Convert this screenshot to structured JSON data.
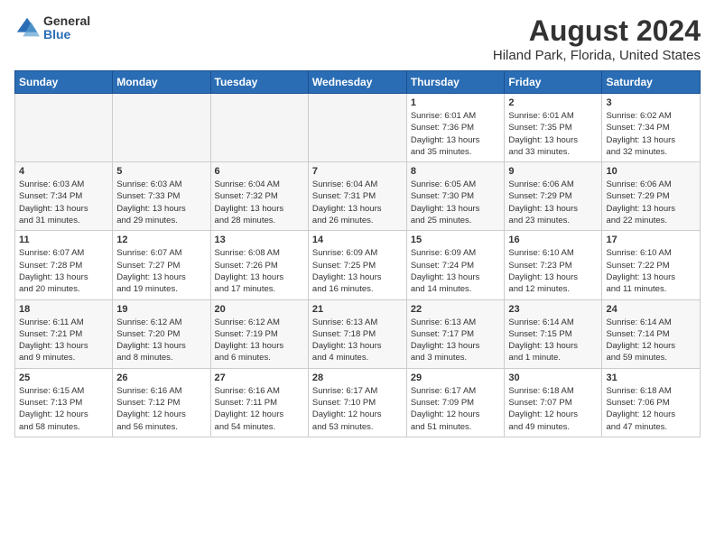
{
  "header": {
    "logo_general": "General",
    "logo_blue": "Blue",
    "title": "August 2024",
    "subtitle": "Hiland Park, Florida, United States"
  },
  "columns": [
    "Sunday",
    "Monday",
    "Tuesday",
    "Wednesday",
    "Thursday",
    "Friday",
    "Saturday"
  ],
  "weeks": [
    [
      {
        "day": "",
        "info": ""
      },
      {
        "day": "",
        "info": ""
      },
      {
        "day": "",
        "info": ""
      },
      {
        "day": "",
        "info": ""
      },
      {
        "day": "1",
        "info": "Sunrise: 6:01 AM\nSunset: 7:36 PM\nDaylight: 13 hours\nand 35 minutes."
      },
      {
        "day": "2",
        "info": "Sunrise: 6:01 AM\nSunset: 7:35 PM\nDaylight: 13 hours\nand 33 minutes."
      },
      {
        "day": "3",
        "info": "Sunrise: 6:02 AM\nSunset: 7:34 PM\nDaylight: 13 hours\nand 32 minutes."
      }
    ],
    [
      {
        "day": "4",
        "info": "Sunrise: 6:03 AM\nSunset: 7:34 PM\nDaylight: 13 hours\nand 31 minutes."
      },
      {
        "day": "5",
        "info": "Sunrise: 6:03 AM\nSunset: 7:33 PM\nDaylight: 13 hours\nand 29 minutes."
      },
      {
        "day": "6",
        "info": "Sunrise: 6:04 AM\nSunset: 7:32 PM\nDaylight: 13 hours\nand 28 minutes."
      },
      {
        "day": "7",
        "info": "Sunrise: 6:04 AM\nSunset: 7:31 PM\nDaylight: 13 hours\nand 26 minutes."
      },
      {
        "day": "8",
        "info": "Sunrise: 6:05 AM\nSunset: 7:30 PM\nDaylight: 13 hours\nand 25 minutes."
      },
      {
        "day": "9",
        "info": "Sunrise: 6:06 AM\nSunset: 7:29 PM\nDaylight: 13 hours\nand 23 minutes."
      },
      {
        "day": "10",
        "info": "Sunrise: 6:06 AM\nSunset: 7:29 PM\nDaylight: 13 hours\nand 22 minutes."
      }
    ],
    [
      {
        "day": "11",
        "info": "Sunrise: 6:07 AM\nSunset: 7:28 PM\nDaylight: 13 hours\nand 20 minutes."
      },
      {
        "day": "12",
        "info": "Sunrise: 6:07 AM\nSunset: 7:27 PM\nDaylight: 13 hours\nand 19 minutes."
      },
      {
        "day": "13",
        "info": "Sunrise: 6:08 AM\nSunset: 7:26 PM\nDaylight: 13 hours\nand 17 minutes."
      },
      {
        "day": "14",
        "info": "Sunrise: 6:09 AM\nSunset: 7:25 PM\nDaylight: 13 hours\nand 16 minutes."
      },
      {
        "day": "15",
        "info": "Sunrise: 6:09 AM\nSunset: 7:24 PM\nDaylight: 13 hours\nand 14 minutes."
      },
      {
        "day": "16",
        "info": "Sunrise: 6:10 AM\nSunset: 7:23 PM\nDaylight: 13 hours\nand 12 minutes."
      },
      {
        "day": "17",
        "info": "Sunrise: 6:10 AM\nSunset: 7:22 PM\nDaylight: 13 hours\nand 11 minutes."
      }
    ],
    [
      {
        "day": "18",
        "info": "Sunrise: 6:11 AM\nSunset: 7:21 PM\nDaylight: 13 hours\nand 9 minutes."
      },
      {
        "day": "19",
        "info": "Sunrise: 6:12 AM\nSunset: 7:20 PM\nDaylight: 13 hours\nand 8 minutes."
      },
      {
        "day": "20",
        "info": "Sunrise: 6:12 AM\nSunset: 7:19 PM\nDaylight: 13 hours\nand 6 minutes."
      },
      {
        "day": "21",
        "info": "Sunrise: 6:13 AM\nSunset: 7:18 PM\nDaylight: 13 hours\nand 4 minutes."
      },
      {
        "day": "22",
        "info": "Sunrise: 6:13 AM\nSunset: 7:17 PM\nDaylight: 13 hours\nand 3 minutes."
      },
      {
        "day": "23",
        "info": "Sunrise: 6:14 AM\nSunset: 7:15 PM\nDaylight: 13 hours\nand 1 minute."
      },
      {
        "day": "24",
        "info": "Sunrise: 6:14 AM\nSunset: 7:14 PM\nDaylight: 12 hours\nand 59 minutes."
      }
    ],
    [
      {
        "day": "25",
        "info": "Sunrise: 6:15 AM\nSunset: 7:13 PM\nDaylight: 12 hours\nand 58 minutes."
      },
      {
        "day": "26",
        "info": "Sunrise: 6:16 AM\nSunset: 7:12 PM\nDaylight: 12 hours\nand 56 minutes."
      },
      {
        "day": "27",
        "info": "Sunrise: 6:16 AM\nSunset: 7:11 PM\nDaylight: 12 hours\nand 54 minutes."
      },
      {
        "day": "28",
        "info": "Sunrise: 6:17 AM\nSunset: 7:10 PM\nDaylight: 12 hours\nand 53 minutes."
      },
      {
        "day": "29",
        "info": "Sunrise: 6:17 AM\nSunset: 7:09 PM\nDaylight: 12 hours\nand 51 minutes."
      },
      {
        "day": "30",
        "info": "Sunrise: 6:18 AM\nSunset: 7:07 PM\nDaylight: 12 hours\nand 49 minutes."
      },
      {
        "day": "31",
        "info": "Sunrise: 6:18 AM\nSunset: 7:06 PM\nDaylight: 12 hours\nand 47 minutes."
      }
    ]
  ]
}
